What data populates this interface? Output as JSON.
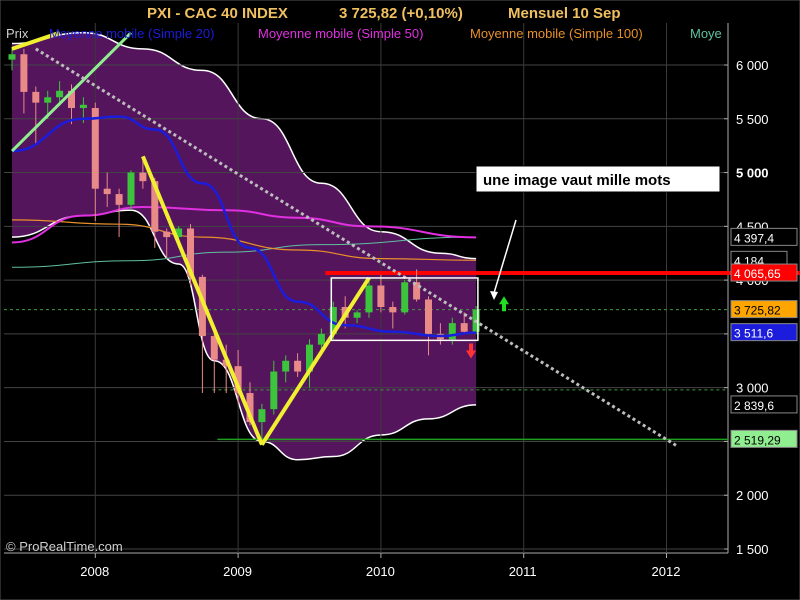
{
  "header": {
    "title": "PXI - CAC 40 INDEX",
    "quote": "3 725,82 (+0,10%)",
    "period": "Mensuel  10 Sep"
  },
  "legend": {
    "price": "Prix",
    "ma20": "Moyenne mobile (Simple 20)",
    "ma50": "Moyenne mobile (Simple 50)",
    "ma100": "Moyenne mobile (Simple 100)",
    "ma_more": "Moye"
  },
  "watermark": "© ProRealTime.com",
  "annotation": "une image vaut mille mots",
  "colors": {
    "background": "#000000",
    "envelope": "#54155c",
    "up_candle": "#3cc43c",
    "down_candle": "#e88a88",
    "ma20": "#1c1cdc",
    "ma50": "#e030e0",
    "ma100": "#e8902a",
    "ma_other": "#60c0a0",
    "trend_yellow": "#f0f030",
    "resistance": "#ff0000",
    "support": "#1ea01e",
    "current_price": "#ffa500"
  },
  "chart_data": {
    "type": "candlestick",
    "title": "PXI - CAC 40 INDEX",
    "interval": "monthly",
    "x_ticks": [
      "2008",
      "2009",
      "2010",
      "2011",
      "2012"
    ],
    "y_ticks": [
      "6 000",
      "5 500",
      "5 000",
      "4 500",
      "4 000",
      "3 500",
      "3 000",
      "2 500",
      "2 000",
      "1 500"
    ],
    "ylim": [
      1500,
      6300
    ],
    "price_labels": [
      {
        "text": "4 397,4",
        "value": 4397.4,
        "bg": "#000000",
        "fg": "#ffffff"
      },
      {
        "text": "4 184",
        "value": 4184,
        "bg": "#000000",
        "fg": "#ffffff"
      },
      {
        "text": "4 065,65",
        "value": 4065.65,
        "bg": "#ff0000",
        "fg": "#ffffff"
      },
      {
        "text": "3 725,82",
        "value": 3725.82,
        "bg": "#ffa500",
        "fg": "#000000"
      },
      {
        "text": "3 511,6",
        "value": 3511.6,
        "bg": "#1c1cdc",
        "fg": "#ffffff"
      },
      {
        "text": "2 839,6",
        "value": 2839.6,
        "bg": "#000000",
        "fg": "#ffffff"
      },
      {
        "text": "2 519,29",
        "value": 2519.29,
        "bg": "#90ee90",
        "fg": "#000000"
      }
    ],
    "candles": [
      {
        "d": "2007-06",
        "o": 6050,
        "h": 6168,
        "l": 5950,
        "c": 6100
      },
      {
        "d": "2007-07",
        "o": 6100,
        "h": 6150,
        "l": 5550,
        "c": 5750
      },
      {
        "d": "2007-08",
        "o": 5750,
        "h": 5800,
        "l": 5250,
        "c": 5650
      },
      {
        "d": "2007-09",
        "o": 5650,
        "h": 5760,
        "l": 5500,
        "c": 5700
      },
      {
        "d": "2007-10",
        "o": 5700,
        "h": 5850,
        "l": 5620,
        "c": 5760
      },
      {
        "d": "2007-11",
        "o": 5760,
        "h": 5820,
        "l": 5450,
        "c": 5600
      },
      {
        "d": "2007-12",
        "o": 5600,
        "h": 5700,
        "l": 5460,
        "c": 5630
      },
      {
        "d": "2008-01",
        "o": 5600,
        "h": 5650,
        "l": 4550,
        "c": 4850
      },
      {
        "d": "2008-02",
        "o": 4850,
        "h": 5000,
        "l": 4680,
        "c": 4800
      },
      {
        "d": "2008-03",
        "o": 4800,
        "h": 4850,
        "l": 4400,
        "c": 4700
      },
      {
        "d": "2008-04",
        "o": 4700,
        "h": 5020,
        "l": 4650,
        "c": 5000
      },
      {
        "d": "2008-05",
        "o": 5000,
        "h": 5150,
        "l": 4850,
        "c": 4920
      },
      {
        "d": "2008-06",
        "o": 4920,
        "h": 4950,
        "l": 4300,
        "c": 4450
      },
      {
        "d": "2008-07",
        "o": 4450,
        "h": 4480,
        "l": 4200,
        "c": 4400
      },
      {
        "d": "2008-08",
        "o": 4400,
        "h": 4500,
        "l": 4300,
        "c": 4480
      },
      {
        "d": "2008-09",
        "o": 4480,
        "h": 4520,
        "l": 3950,
        "c": 4030
      },
      {
        "d": "2008-10",
        "o": 4030,
        "h": 4050,
        "l": 2950,
        "c": 3480
      },
      {
        "d": "2008-11",
        "o": 3480,
        "h": 3550,
        "l": 2950,
        "c": 3260
      },
      {
        "d": "2008-12",
        "o": 3260,
        "h": 3400,
        "l": 2950,
        "c": 3200
      },
      {
        "d": "2009-01",
        "o": 3200,
        "h": 3350,
        "l": 2850,
        "c": 2950
      },
      {
        "d": "2009-02",
        "o": 2950,
        "h": 3050,
        "l": 2650,
        "c": 2680
      },
      {
        "d": "2009-03",
        "o": 2680,
        "h": 2850,
        "l": 2465,
        "c": 2800
      },
      {
        "d": "2009-04",
        "o": 2800,
        "h": 3250,
        "l": 2750,
        "c": 3150
      },
      {
        "d": "2009-05",
        "o": 3150,
        "h": 3300,
        "l": 3050,
        "c": 3250
      },
      {
        "d": "2009-06",
        "o": 3250,
        "h": 3320,
        "l": 3100,
        "c": 3150
      },
      {
        "d": "2009-07",
        "o": 3150,
        "h": 3450,
        "l": 3000,
        "c": 3400
      },
      {
        "d": "2009-08",
        "o": 3400,
        "h": 3550,
        "l": 3300,
        "c": 3500
      },
      {
        "d": "2009-09",
        "o": 3500,
        "h": 3800,
        "l": 3450,
        "c": 3750
      },
      {
        "d": "2009-10",
        "o": 3750,
        "h": 3850,
        "l": 3550,
        "c": 3650
      },
      {
        "d": "2009-11",
        "o": 3650,
        "h": 3720,
        "l": 3600,
        "c": 3700
      },
      {
        "d": "2009-12",
        "o": 3700,
        "h": 4000,
        "l": 3650,
        "c": 3950
      },
      {
        "d": "2010-01",
        "o": 3950,
        "h": 4050,
        "l": 3700,
        "c": 3750
      },
      {
        "d": "2010-02",
        "o": 3750,
        "h": 3800,
        "l": 3550,
        "c": 3700
      },
      {
        "d": "2010-03",
        "o": 3700,
        "h": 4000,
        "l": 3680,
        "c": 3980
      },
      {
        "d": "2010-04",
        "o": 3980,
        "h": 4100,
        "l": 3800,
        "c": 3820
      },
      {
        "d": "2010-05",
        "o": 3820,
        "h": 3850,
        "l": 3300,
        "c": 3500
      },
      {
        "d": "2010-06",
        "o": 3500,
        "h": 3600,
        "l": 3400,
        "c": 3450
      },
      {
        "d": "2010-07",
        "o": 3450,
        "h": 3650,
        "l": 3400,
        "c": 3600
      },
      {
        "d": "2010-08",
        "o": 3600,
        "h": 3700,
        "l": 3500,
        "c": 3520
      },
      {
        "d": "2010-09",
        "o": 3520,
        "h": 3760,
        "l": 3500,
        "c": 3726
      }
    ],
    "ma20": [
      {
        "d": "2007-06",
        "v": 5200
      },
      {
        "d": "2007-12",
        "v": 5500
      },
      {
        "d": "2008-03",
        "v": 5520
      },
      {
        "d": "2008-06",
        "v": 5400
      },
      {
        "d": "2008-10",
        "v": 4900
      },
      {
        "d": "2009-02",
        "v": 4300
      },
      {
        "d": "2009-06",
        "v": 3800
      },
      {
        "d": "2009-10",
        "v": 3580
      },
      {
        "d": "2010-02",
        "v": 3520
      },
      {
        "d": "2010-06",
        "v": 3480
      },
      {
        "d": "2010-09",
        "v": 3511.6
      }
    ],
    "ma50": [
      {
        "d": "2007-06",
        "v": 4350
      },
      {
        "d": "2007-12",
        "v": 4600
      },
      {
        "d": "2008-05",
        "v": 4680
      },
      {
        "d": "2008-12",
        "v": 4650
      },
      {
        "d": "2009-06",
        "v": 4580
      },
      {
        "d": "2009-12",
        "v": 4500
      },
      {
        "d": "2010-09",
        "v": 4397.4
      }
    ],
    "ma100": [
      {
        "d": "2007-06",
        "v": 4560
      },
      {
        "d": "2008-03",
        "v": 4520
      },
      {
        "d": "2008-10",
        "v": 4400
      },
      {
        "d": "2009-06",
        "v": 4280
      },
      {
        "d": "2010-01",
        "v": 4200
      },
      {
        "d": "2010-09",
        "v": 4184
      }
    ],
    "ma_other": [
      {
        "d": "2007-06",
        "v": 4120
      },
      {
        "d": "2008-04",
        "v": 4180
      },
      {
        "d": "2008-12",
        "v": 4260
      },
      {
        "d": "2009-08",
        "v": 4330
      },
      {
        "d": "2010-09",
        "v": 4400
      }
    ],
    "envelope_upper": [
      {
        "d": "2007-06",
        "v": 6200
      },
      {
        "d": "2007-12",
        "v": 6300
      },
      {
        "d": "2008-05",
        "v": 6150
      },
      {
        "d": "2008-10",
        "v": 5950
      },
      {
        "d": "2009-03",
        "v": 5500
      },
      {
        "d": "2009-08",
        "v": 4900
      },
      {
        "d": "2010-01",
        "v": 4450
      },
      {
        "d": "2010-06",
        "v": 4250
      },
      {
        "d": "2010-09",
        "v": 4200
      }
    ],
    "envelope_lower": [
      {
        "d": "2007-06",
        "v": 4400
      },
      {
        "d": "2007-12",
        "v": 4600
      },
      {
        "d": "2008-04",
        "v": 4650
      },
      {
        "d": "2008-08",
        "v": 4150
      },
      {
        "d": "2008-11",
        "v": 3250
      },
      {
        "d": "2009-03",
        "v": 2500
      },
      {
        "d": "2009-06",
        "v": 2330
      },
      {
        "d": "2009-09",
        "v": 2360
      },
      {
        "d": "2010-01",
        "v": 2560
      },
      {
        "d": "2010-05",
        "v": 2710
      },
      {
        "d": "2010-09",
        "v": 2839.6
      }
    ],
    "trendlines": [
      {
        "kind": "yellow",
        "from": {
          "d": "2008-05",
          "v": 5150
        },
        "to": {
          "d": "2009-03",
          "v": 2470
        }
      },
      {
        "kind": "yellow",
        "from": {
          "d": "2009-03",
          "v": 2470
        },
        "to": {
          "d": "2009-12",
          "v": 4020
        }
      },
      {
        "kind": "green",
        "from": {
          "d": "2007-06",
          "v": 5200
        },
        "to": {
          "d": "2008-04",
          "v": 6300
        }
      },
      {
        "kind": "yellow",
        "from": {
          "d": "2007-06",
          "v": 6150
        },
        "to": {
          "d": "2007-10",
          "v": 6300
        }
      },
      {
        "kind": "dotted",
        "from": {
          "d": "2007-08",
          "v": 6150
        },
        "to": {
          "d": "2012-02",
          "v": 2450
        }
      }
    ],
    "levels": [
      {
        "kind": "resistance",
        "v": 4065.65,
        "from": "2009-10",
        "to": "2012-12"
      },
      {
        "kind": "current",
        "v": 3725.82,
        "from": "2007-06",
        "to": "2012-12"
      },
      {
        "kind": "support_mid",
        "v": 2980,
        "from": "2008-10",
        "to": "2012-12"
      },
      {
        "kind": "support",
        "v": 2519.29,
        "from": "2008-10",
        "to": "2012-12"
      }
    ],
    "box": {
      "from": "2009-09",
      "to": "2010-11",
      "v_top": 4020,
      "v_bottom": 3440
    }
  }
}
